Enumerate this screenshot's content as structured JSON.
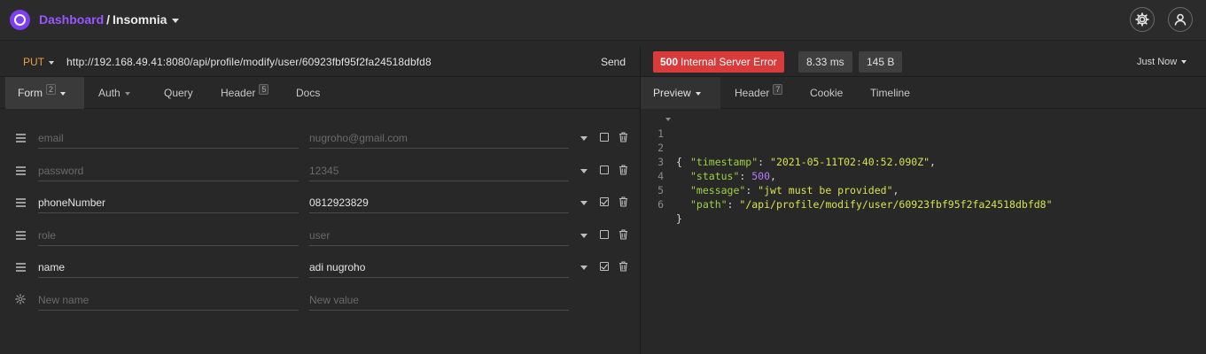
{
  "header": {
    "breadcrumb_dashboard": "Dashboard",
    "breadcrumb_separator": "/",
    "breadcrumb_app": "Insomnia",
    "settings_icon": "gear-icon",
    "account_icon": "user-icon"
  },
  "request": {
    "method": "PUT",
    "url": "http://192.168.49.41:8080/api/profile/modify/user/60923fbf95f2fa24518dbfd8",
    "send_label": "Send",
    "tabs": [
      {
        "label": "Form",
        "badge": "2"
      },
      {
        "label": "Auth"
      },
      {
        "label": "Query"
      },
      {
        "label": "Header",
        "badge": "5"
      },
      {
        "label": "Docs"
      }
    ]
  },
  "form": {
    "rows": [
      {
        "name": "email",
        "value": "nugroho@gmail.com",
        "enabled": false
      },
      {
        "name": "password",
        "value": "12345",
        "enabled": false
      },
      {
        "name": "phoneNumber",
        "value": "0812923829",
        "enabled": true
      },
      {
        "name": "role",
        "value": "user",
        "enabled": false
      },
      {
        "name": "name",
        "value": "adi nugroho",
        "enabled": true
      }
    ],
    "new_name_placeholder": "New name",
    "new_value_placeholder": "New value"
  },
  "response": {
    "status_code": "500",
    "status_text": "Internal Server Error",
    "time": "8.33 ms",
    "size": "145 B",
    "history_label": "Just Now",
    "tabs": [
      {
        "label": "Preview"
      },
      {
        "label": "Header",
        "badge": "7"
      },
      {
        "label": "Cookie"
      },
      {
        "label": "Timeline"
      }
    ],
    "line_numbers": [
      "1",
      "2",
      "3",
      "4",
      "5",
      "6"
    ],
    "body": {
      "open_brace": "{",
      "close_brace": "}",
      "timestamp_key": "\"timestamp\"",
      "timestamp_value": "\"2021-05-11T02:40:52.090Z\"",
      "status_key": "\"status\"",
      "status_value": "500",
      "message_key": "\"message\"",
      "message_value": "\"jwt must be provided\"",
      "path_key": "\"path\"",
      "path_value": "\"/api/profile/modify/user/60923fbf95f2fa24518dbfd8\""
    }
  },
  "colors": {
    "accent": "#7e3ff2",
    "method": "#e8a23a",
    "error": "#d93b3b",
    "json_key": "#9ad43f",
    "json_string": "#d8e34a",
    "json_number": "#b67dff"
  }
}
